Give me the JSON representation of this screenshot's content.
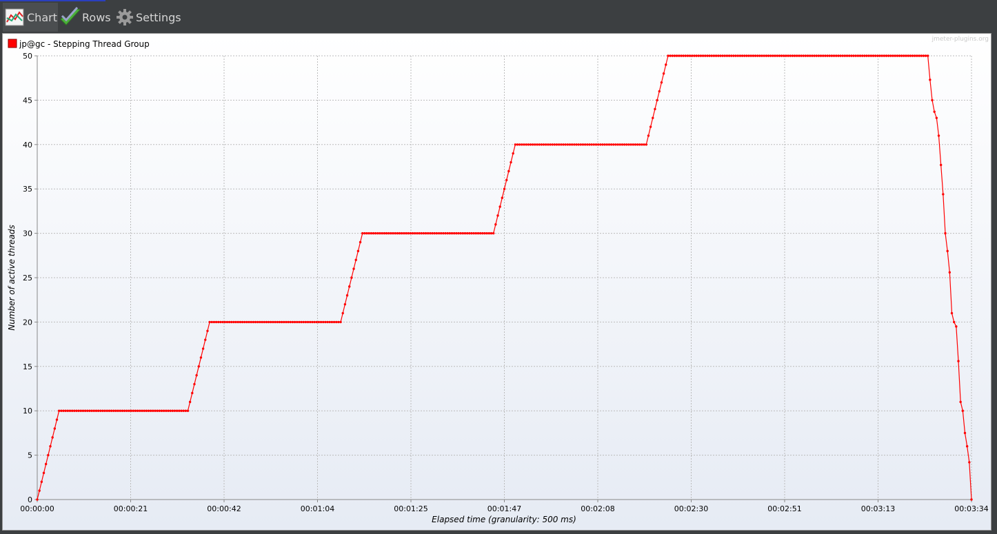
{
  "tabs": [
    {
      "label": "Chart",
      "icon": "chart-icon",
      "active": true
    },
    {
      "label": "Rows",
      "icon": "checkmark-icon",
      "active": false
    },
    {
      "label": "Settings",
      "icon": "gear-icon",
      "active": false
    }
  ],
  "watermark": "jmeter-plugins.org",
  "chart_data": {
    "type": "line",
    "legend": "jp@gc - Stepping Thread Group",
    "legend_placement": "top-left",
    "series_color": "#ff0000",
    "xlabel": "Elapsed time (granularity: 500 ms)",
    "ylabel": "Number of active threads",
    "grid": true,
    "ylim": [
      0,
      50
    ],
    "yticks": [
      "0",
      "5",
      "10",
      "15",
      "20",
      "25",
      "30",
      "35",
      "40",
      "45",
      "50"
    ],
    "xlim_seconds": [
      0,
      214
    ],
    "xticks": [
      "00:00:00",
      "00:00:21",
      "00:00:42",
      "00:01:04",
      "00:01:25",
      "00:01:47",
      "00:02:08",
      "00:02:30",
      "00:02:51",
      "00:03:13",
      "00:03:34"
    ],
    "granularity_seconds": 0.5,
    "series": [
      {
        "name": "jp@gc - Stepping Thread Group",
        "points": [
          [
            0,
            0
          ],
          [
            0.5,
            1
          ],
          [
            1,
            2
          ],
          [
            1.5,
            3
          ],
          [
            2,
            4
          ],
          [
            2.5,
            5
          ],
          [
            3,
            6
          ],
          [
            3.5,
            7
          ],
          [
            4,
            8
          ],
          [
            4.5,
            9
          ],
          [
            5,
            10
          ],
          [
            34.5,
            10
          ],
          [
            35,
            11
          ],
          [
            35.5,
            12
          ],
          [
            36,
            13
          ],
          [
            36.5,
            14
          ],
          [
            37,
            15
          ],
          [
            37.5,
            16
          ],
          [
            38,
            17
          ],
          [
            38.5,
            18
          ],
          [
            39,
            19
          ],
          [
            39.5,
            20
          ],
          [
            69.5,
            20
          ],
          [
            70,
            21
          ],
          [
            70.5,
            22
          ],
          [
            71,
            23
          ],
          [
            71.5,
            24
          ],
          [
            72,
            25
          ],
          [
            72.5,
            26
          ],
          [
            73,
            27
          ],
          [
            73.5,
            28
          ],
          [
            74,
            29
          ],
          [
            74.5,
            30
          ],
          [
            104.5,
            30
          ],
          [
            105,
            31
          ],
          [
            105.5,
            32
          ],
          [
            106,
            33
          ],
          [
            106.5,
            34
          ],
          [
            107,
            35
          ],
          [
            107.5,
            36
          ],
          [
            108,
            37
          ],
          [
            108.5,
            38
          ],
          [
            109,
            39
          ],
          [
            109.5,
            40
          ],
          [
            139.5,
            40
          ],
          [
            140,
            41
          ],
          [
            140.5,
            42
          ],
          [
            141,
            43
          ],
          [
            141.5,
            44
          ],
          [
            142,
            45
          ],
          [
            142.5,
            46
          ],
          [
            143,
            47
          ],
          [
            143.5,
            48
          ],
          [
            144,
            49
          ],
          [
            144.5,
            50
          ],
          [
            204,
            50
          ],
          [
            204.5,
            47.3
          ],
          [
            205,
            45
          ],
          [
            205.5,
            43.7
          ],
          [
            206,
            43
          ],
          [
            206.5,
            41
          ],
          [
            207,
            37.7
          ],
          [
            207.5,
            34.4
          ],
          [
            208,
            30
          ],
          [
            208.5,
            28
          ],
          [
            209,
            25.6
          ],
          [
            209.5,
            21
          ],
          [
            210,
            20
          ],
          [
            210.5,
            19.5
          ],
          [
            211,
            15.6
          ],
          [
            211.5,
            11
          ],
          [
            212,
            10
          ],
          [
            212.5,
            7.5
          ],
          [
            213,
            6
          ],
          [
            213.5,
            4.2
          ],
          [
            214,
            0
          ]
        ]
      }
    ]
  }
}
